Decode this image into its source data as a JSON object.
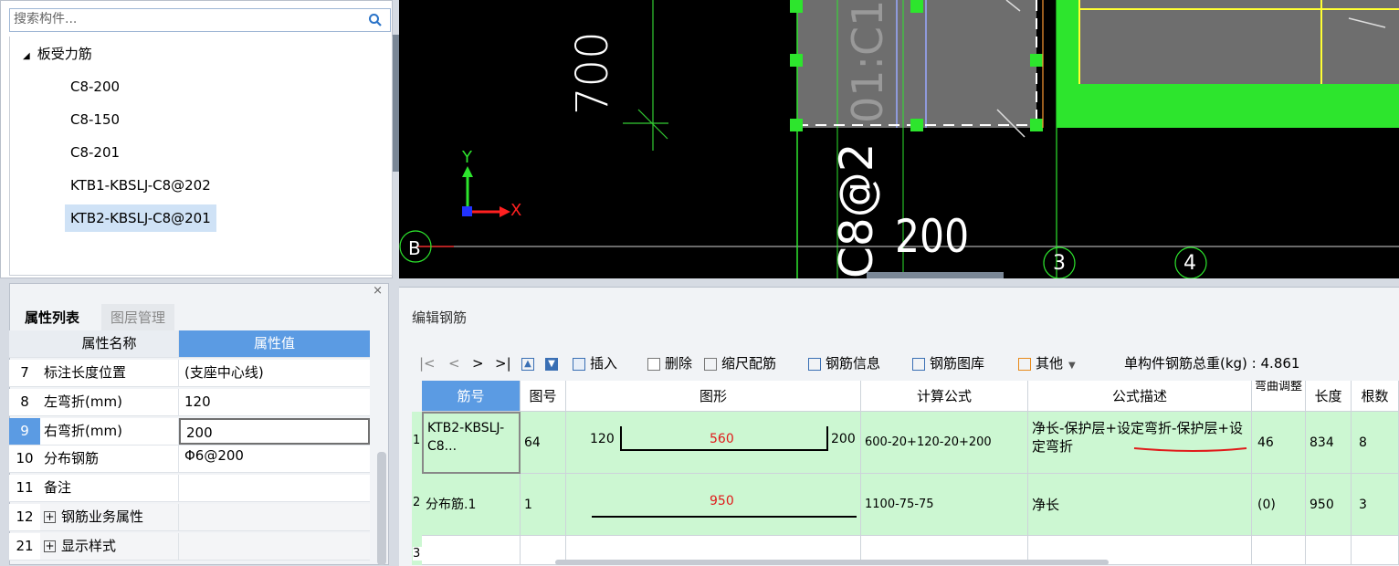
{
  "tree": {
    "search_placeholder": "搜索构件...",
    "root_label": "板受力筋",
    "items": [
      "C8-200",
      "C8-150",
      "C8-201",
      "KTB1-KBSLJ-C8@202",
      "KTB2-KBSLJ-C8@201"
    ],
    "selected_index": 4
  },
  "cad": {
    "dim_700": "700",
    "dim_200": "200",
    "rebar_label": "C8@2",
    "rebar_vert": "01:C1",
    "axis_y": "Y",
    "axis_x": "X",
    "grid_b": "B",
    "grid_3": "3",
    "grid_4": "4"
  },
  "props": {
    "tabs": [
      "属性列表",
      "图层管理"
    ],
    "header_name": "属性名称",
    "header_value": "属性值",
    "rows": [
      {
        "num": "7",
        "name": "标注长度位置",
        "value": "(支座中心线)"
      },
      {
        "num": "8",
        "name": "左弯折(mm)",
        "value": "120"
      },
      {
        "num": "9",
        "name": "右弯折(mm)",
        "value": "200"
      },
      {
        "num": "10",
        "name": "分布钢筋",
        "value": "Φ6@200"
      },
      {
        "num": "11",
        "name": "备注",
        "value": ""
      },
      {
        "num": "12",
        "name": "钢筋业务属性",
        "value": ""
      },
      {
        "num": "21",
        "name": "显示样式",
        "value": ""
      }
    ]
  },
  "rebar": {
    "panel_title": "编辑钢筋",
    "nav": [
      "|<",
      "<",
      ">",
      ">|"
    ],
    "toolbar": {
      "insert": "插入",
      "delete": "删除",
      "scale": "缩尺配筋",
      "info": "钢筋信息",
      "library": "钢筋图库",
      "other": "其他",
      "total_weight": "单构件钢筋总重(kg) : 4.861"
    },
    "columns": [
      "筋号",
      "图号",
      "图形",
      "计算公式",
      "公式描述",
      "弯曲调整",
      "长度",
      "根数"
    ],
    "rows": [
      {
        "row_no": "1",
        "bar": "KTB2-KBSLJ-C8...",
        "fig_no": "64",
        "left": "120",
        "mid": "560",
        "right": "200",
        "formula": "600-20+120-20+200",
        "desc": "净长-保护层+设定弯折-保护层+设定弯折",
        "bend": "46",
        "length": "834",
        "count": "8"
      },
      {
        "row_no": "2",
        "bar": "分布筋.1",
        "fig_no": "1",
        "left": "",
        "mid": "950",
        "right": "",
        "formula": "1100-75-75",
        "desc": "净长",
        "bend": "(0)",
        "length": "950",
        "count": "3"
      },
      {
        "row_no": "3",
        "bar": "",
        "fig_no": "",
        "left": "",
        "mid": "",
        "right": "",
        "formula": "",
        "desc": "",
        "bend": "",
        "length": "",
        "count": ""
      }
    ]
  }
}
